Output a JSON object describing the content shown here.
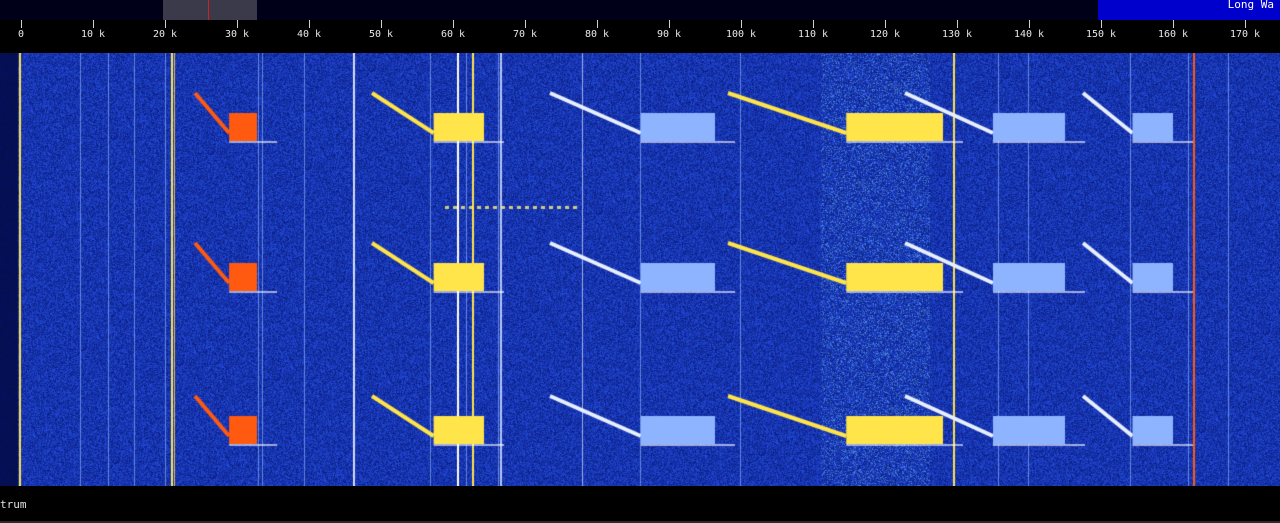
{
  "band_bar": {
    "label": "Long Wa",
    "label_color": "#0000cc",
    "scroll_color": "#3a3a4a",
    "cursor_color": "#d02020"
  },
  "scale": {
    "ticks": [
      "0",
      "10 k",
      "20 k",
      "30 k",
      "40 k",
      "50 k",
      "60 k",
      "70 k",
      "80 k",
      "90 k",
      "100 k",
      "110 k",
      "120 k",
      "130 k",
      "140 k",
      "150 k",
      "160 k",
      "170 k"
    ],
    "tick_values": [
      0,
      10,
      20,
      30,
      40,
      50,
      60,
      70,
      80,
      90,
      100,
      110,
      120,
      130,
      140,
      150,
      160,
      170
    ]
  },
  "waterfall": {
    "background_color": "#0a2aa8",
    "carrier_color": "#ffe44a",
    "hot_color": "#ff5a10",
    "signal_color": "#8fb4ff"
  },
  "status": {
    "text": "trum"
  }
}
